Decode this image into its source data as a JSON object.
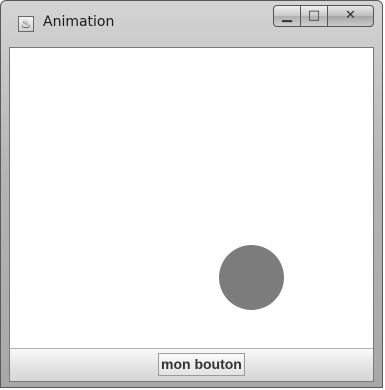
{
  "window": {
    "title": "Animation",
    "app_icon": "java-cup-icon"
  },
  "controls": {
    "minimize_glyph": "▁",
    "maximize_glyph": "□",
    "close_glyph": "✕"
  },
  "canvas": {
    "ball_color": "#7c7c7c"
  },
  "button_bar": {
    "button_label": "mon bouton"
  }
}
